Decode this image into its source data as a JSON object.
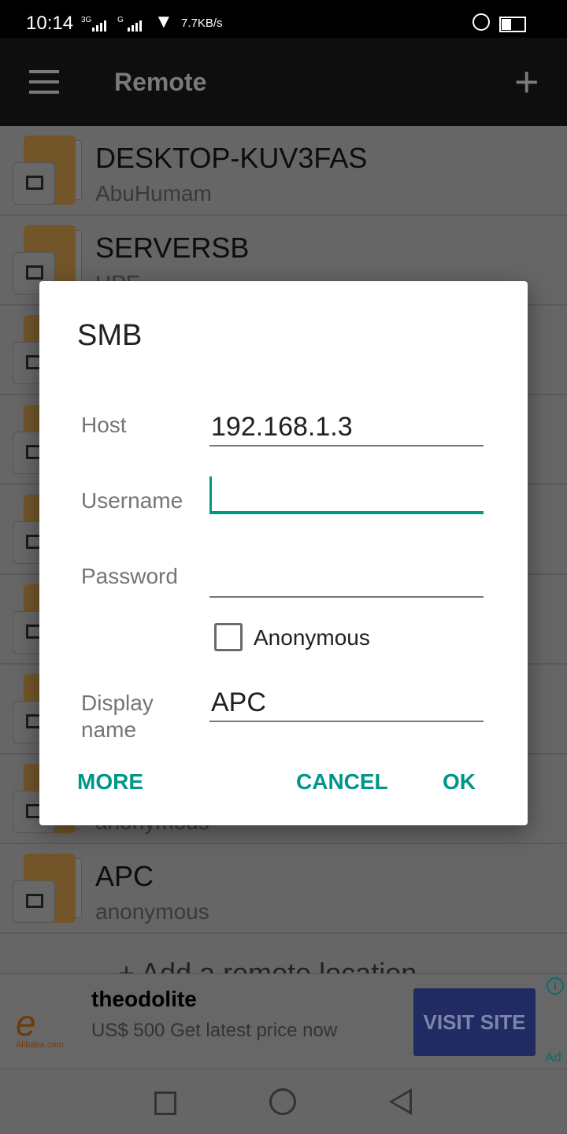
{
  "status_bar": {
    "time": "10:14",
    "network1": "3G",
    "network2": "G",
    "speed": "7.7KB/s",
    "icons": [
      "signal-icon",
      "wifi-icon",
      "alarm-icon",
      "battery-icon"
    ]
  },
  "app_bar": {
    "title": "Remote",
    "menu_icon": "hamburger-icon",
    "add_icon": "plus-icon"
  },
  "list": {
    "items": [
      {
        "title": "DESKTOP-KUV3FAS",
        "subtitle": "AbuHumam"
      },
      {
        "title": "SERVERSB",
        "subtitle": "HPE"
      },
      {},
      {},
      {},
      {},
      {},
      {
        "subtitle": "anonymous"
      },
      {
        "title": "APC",
        "subtitle": "anonymous"
      }
    ],
    "add_label": "+ Add a remote location"
  },
  "ad": {
    "brand": "Alibaba.com",
    "title": "theodolite",
    "subtitle": "US$ 500 Get latest price now",
    "cta": "VISIT SITE",
    "badge": "Ad",
    "info": "i"
  },
  "dialog": {
    "title": "SMB",
    "host_label": "Host",
    "host_value": "192.168.1.3",
    "username_label": "Username",
    "username_value": "",
    "password_label": "Password",
    "password_value": "",
    "anonymous_label": "Anonymous",
    "anonymous_checked": false,
    "display_label": "Display name",
    "display_value": "APC",
    "more": "MORE",
    "cancel": "CANCEL",
    "ok": "OK"
  },
  "colors": {
    "accent": "#009688",
    "cta": "#202a63"
  }
}
